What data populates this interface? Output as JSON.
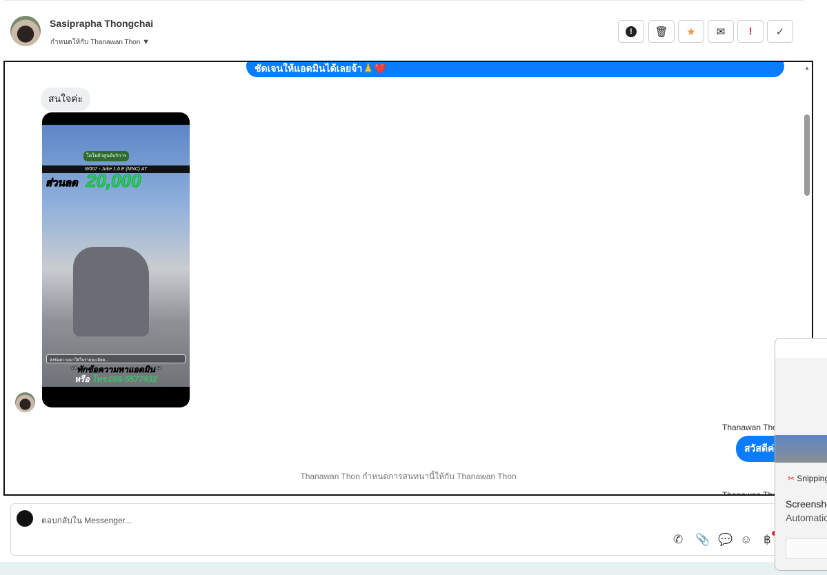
{
  "header": {
    "contact_name": "Sasiprapha Thongchai",
    "assigned_label": "กำหนดให้กับ Thanawan Thon"
  },
  "toolbar": {
    "spam": "spam",
    "delete": "delete",
    "star": "star",
    "mark_unread": "mark-unread",
    "important": "!",
    "done": "done"
  },
  "colors": {
    "accent": "#0a7cff",
    "star": "#f5923e",
    "important": "#e0282e"
  },
  "messages": {
    "outgoing_top": "ชัดเจนให้แอดมินได้เลยจ้า🙏❤️",
    "incoming_text": "สนใจค่ะ",
    "ad": {
      "logo_text": "โตโยต้าศูนย์บริการ",
      "model": "W007 - Juke 1.6 E (MNC) AT",
      "discount_label": "ส่วนลด",
      "discount_value": "20,000",
      "notice": "ส่งข้อความมาให้ในรายละเอียด...",
      "cta": "**ทักข้อความหาแอดมิน**",
      "phone_prefix": "หรือ",
      "phone": "โทร.088-5577932"
    },
    "sender_1": "Thanawan Thon",
    "outgoing_greeting": "สวัสดีค่ะ",
    "system_note": "Thanawan Thon กำหนดการสนทนานี้ให้กับ Thanawan Thon",
    "sender_2": "Thanawan Thon"
  },
  "composer": {
    "placeholder": "ตอบกลับใน Messenger..."
  },
  "notification": {
    "app": "Snipping Tool",
    "title": "Screenshot",
    "body": "Automatically saved"
  }
}
